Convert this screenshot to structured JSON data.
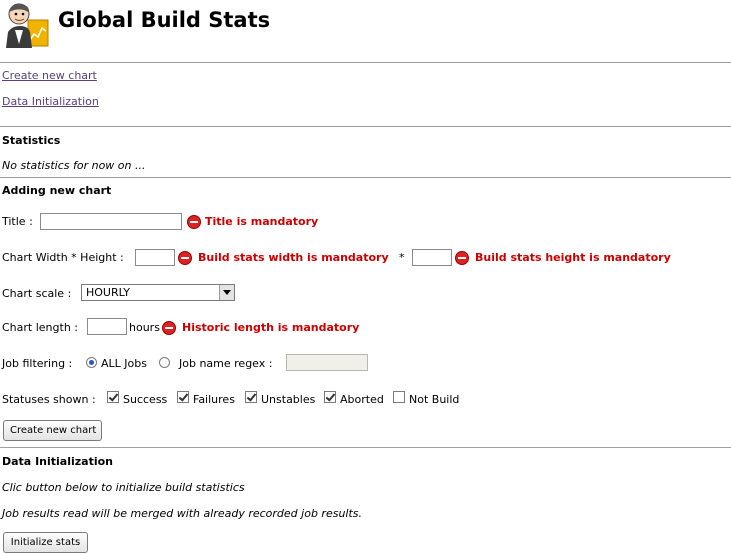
{
  "header": {
    "title": "Global Build Stats",
    "logo_icon": "jenkins-butler-logo"
  },
  "links": {
    "create_chart": "Create new chart",
    "data_init": "Data Initialization"
  },
  "statistics": {
    "heading": "Statistics",
    "empty_text": "No statistics for now on ..."
  },
  "new_chart": {
    "heading": "Adding new chart",
    "title_label": "Title :",
    "title_value": "",
    "title_error": "Title is mandatory",
    "size_label": "Chart Width * Height :",
    "width_value": "",
    "width_error": "Build stats width is mandatory",
    "star": "*",
    "height_value": "",
    "height_error": "Build stats height is mandatory",
    "scale_label": "Chart scale :",
    "scale_value": "HOURLY",
    "length_label": "Chart length :",
    "length_value": "",
    "length_unit": "hours",
    "length_error": "Historic length is mandatory",
    "filter_label": "Job filtering :",
    "filter_all": "ALL Jobs",
    "filter_regex": "Job name regex :",
    "regex_value": "",
    "statuses_label": "Statuses shown :",
    "statuses": [
      {
        "label": "Success",
        "checked": true
      },
      {
        "label": "Failures",
        "checked": true
      },
      {
        "label": "Unstables",
        "checked": true
      },
      {
        "label": "Aborted",
        "checked": true
      },
      {
        "label": "Not Build",
        "checked": false
      }
    ],
    "submit_label": "Create new chart"
  },
  "data_init": {
    "heading": "Data Initialization",
    "line1": "Clic button below to initialize build statistics",
    "line2": "Job results read will be merged with already recorded job results.",
    "button_label": "Initialize stats"
  },
  "colors": {
    "error": "#cc0000",
    "link": "#5a3f7a",
    "divider": "#a0a0a0"
  }
}
